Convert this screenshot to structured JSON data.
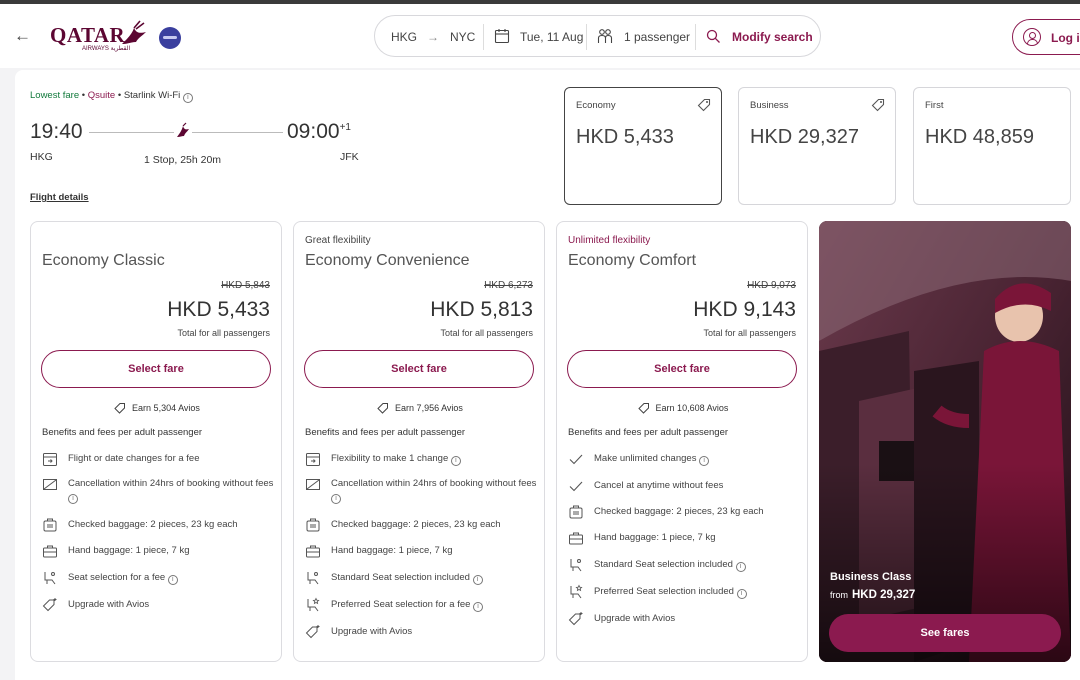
{
  "header": {
    "logo_text": "QATAR",
    "logo_sub": "AIRWAYS القطرية",
    "search": {
      "from": "HKG",
      "to": "NYC",
      "date": "Tue, 11 Aug",
      "passengers": "1 passenger",
      "modify_label": "Modify search"
    },
    "login_label": "Log in"
  },
  "flight": {
    "tags": [
      "Lowest fare",
      "Qsuite",
      "Starlink Wi-Fi"
    ],
    "dep_time": "19:40",
    "arr_time": "09:00",
    "arr_day_offset": "+1",
    "dep_code": "HKG",
    "arr_code": "JFK",
    "stops": "1 Stop, 25h 20m",
    "details_link": "Flight details"
  },
  "cabins": [
    {
      "name": "Economy",
      "price": "HKD 5,433",
      "selected": true
    },
    {
      "name": "Business",
      "price": "HKD 29,327"
    },
    {
      "name": "First",
      "price": "HKD 48,859"
    }
  ],
  "fares": [
    {
      "eyebrow": "",
      "title": "Economy Classic",
      "old_price": "HKD 5,843",
      "price": "HKD 5,433",
      "total_note": "Total for all passengers",
      "button": "Select fare",
      "avios": "Earn 5,304 Avios",
      "benefits_heading": "Benefits and fees per adult passenger",
      "benefits": [
        {
          "icon": "calendar-icon",
          "text": "Flight or date changes for a fee"
        },
        {
          "icon": "cancel-ticket-icon",
          "text": "Cancellation within 24hrs of booking without fees"
        },
        {
          "icon": "checked-bag-icon",
          "text": "Checked baggage: 2 pieces, 23 kg each"
        },
        {
          "icon": "hand-bag-icon",
          "text": "Hand baggage: 1 piece, 7 kg"
        },
        {
          "icon": "seat-icon",
          "text": "Seat selection for a fee"
        },
        {
          "icon": "upgrade-tag-icon",
          "text": "Upgrade with Avios"
        }
      ]
    },
    {
      "eyebrow": "Great flexibility",
      "title": "Economy Convenience",
      "old_price": "HKD 6,273",
      "price": "HKD 5,813",
      "total_note": "Total for all passengers",
      "button": "Select fare",
      "avios": "Earn 7,956 Avios",
      "benefits_heading": "Benefits and fees per adult passenger",
      "benefits": [
        {
          "icon": "calendar-icon",
          "text": "Flexibility to make 1 change"
        },
        {
          "icon": "cancel-ticket-icon",
          "text": "Cancellation within 24hrs of booking without fees"
        },
        {
          "icon": "checked-bag-icon",
          "text": "Checked baggage: 2 pieces, 23 kg each"
        },
        {
          "icon": "hand-bag-icon",
          "text": "Hand baggage: 1 piece, 7 kg"
        },
        {
          "icon": "seat-icon",
          "text": "Standard Seat selection included"
        },
        {
          "icon": "preferred-seat-icon",
          "text": "Preferred Seat selection for a fee"
        },
        {
          "icon": "upgrade-tag-icon",
          "text": "Upgrade with Avios"
        }
      ]
    },
    {
      "eyebrow": "Unlimited flexibility",
      "title": "Economy Comfort",
      "old_price": "HKD 9,073",
      "price": "HKD 9,143",
      "total_note": "Total for all passengers",
      "button": "Select fare",
      "avios": "Earn 10,608 Avios",
      "benefits_heading": "Benefits and fees per adult passenger",
      "benefits": [
        {
          "icon": "check-icon",
          "text": "Make unlimited changes"
        },
        {
          "icon": "check-icon",
          "text": "Cancel at anytime without fees"
        },
        {
          "icon": "checked-bag-icon",
          "text": "Checked baggage: 2 pieces, 23 kg each"
        },
        {
          "icon": "hand-bag-icon",
          "text": "Hand baggage: 1 piece, 7 kg"
        },
        {
          "icon": "seat-icon",
          "text": "Standard Seat selection included"
        },
        {
          "icon": "preferred-seat-icon",
          "text": "Preferred Seat selection included"
        },
        {
          "icon": "upgrade-tag-icon",
          "text": "Upgrade with Avios"
        }
      ]
    }
  ],
  "promo": {
    "title": "Business Class",
    "from_label": "from",
    "price": "HKD 29,327",
    "button": "See fares"
  },
  "colors": {
    "brand": "#5c0632",
    "accent": "#8b1a4f",
    "green": "#127a3c"
  }
}
